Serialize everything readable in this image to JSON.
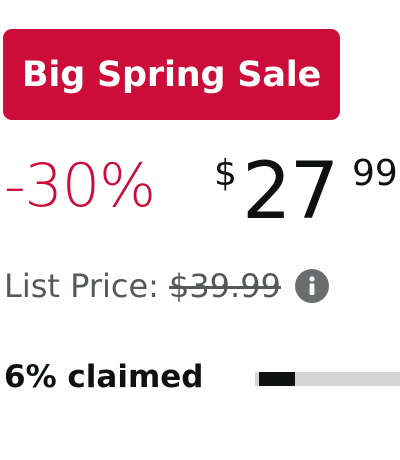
{
  "deal": {
    "badge_label": "Big Spring Sale",
    "accent_color": "#CC0C39"
  },
  "pricing": {
    "savings_percent": "-30%",
    "currency_symbol": "$",
    "price_whole": "27",
    "price_fraction": "99",
    "list_price_label": "List Price:",
    "list_price_value": "$39.99",
    "info_icon": "info-icon"
  },
  "claim": {
    "claimed_text": "6% claimed",
    "claimed_fraction": 0.06
  }
}
